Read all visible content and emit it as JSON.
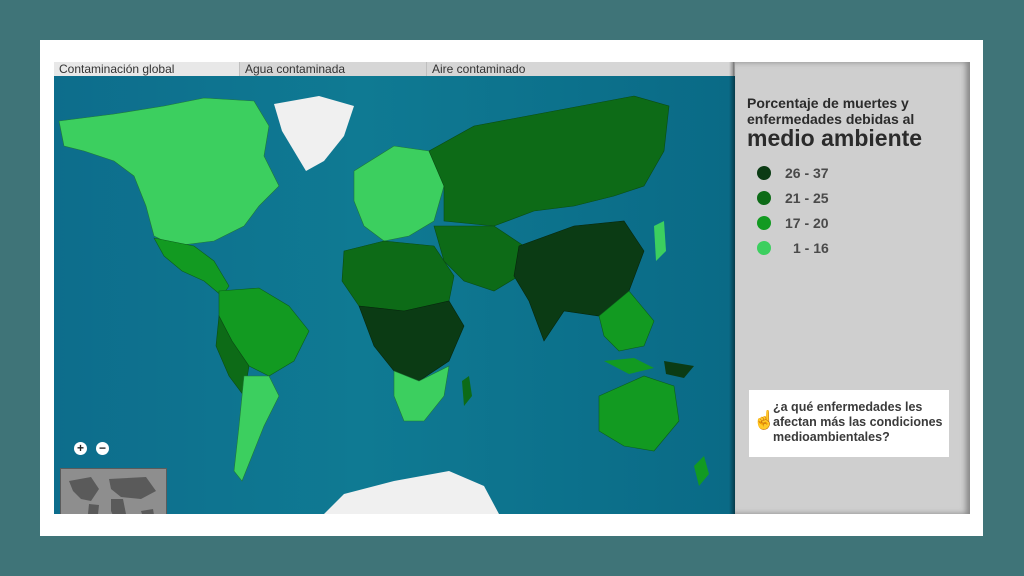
{
  "tabs": [
    {
      "label": "Contaminación global",
      "active": true
    },
    {
      "label": "Agua contaminada",
      "active": false
    },
    {
      "label": "Aire contaminado",
      "active": false
    }
  ],
  "panel": {
    "title_small": "Porcentaje de muertes y enfermedades debidas al",
    "title_big": "medio ambiente",
    "legend": [
      {
        "label": "26 - 37",
        "color": "#0b3b14"
      },
      {
        "label": "21 - 25",
        "color": "#0d6b17"
      },
      {
        "label": "17 - 20",
        "color": "#129a21"
      },
      {
        "label": "1 - 16",
        "color": "#3ccf5f"
      }
    ],
    "question": "¿a qué enfermedades les afectan más las condiciones medioambientales?"
  },
  "map": {
    "zoom_in": "+",
    "zoom_out": "−",
    "colors": {
      "ocean": "#0d7190",
      "ice": "#f2f2f2",
      "level_1_16": "#3ccf5f",
      "level_17_20": "#129a21",
      "level_21_25": "#0d6b17",
      "level_26_37": "#0b3b14"
    }
  }
}
